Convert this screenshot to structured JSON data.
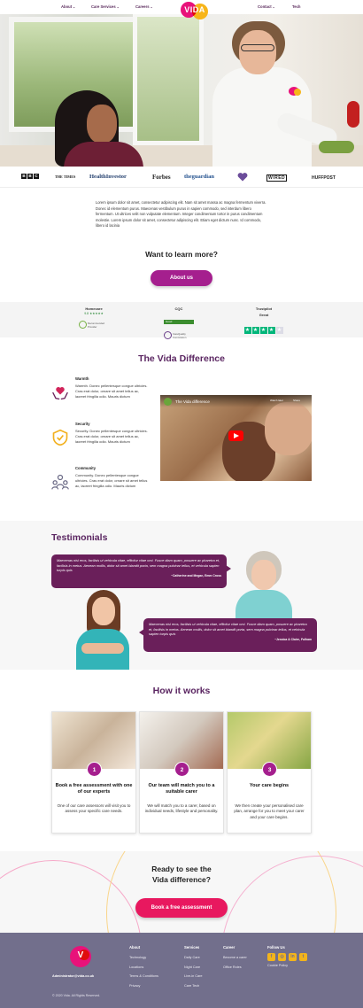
{
  "nav": {
    "about": "About",
    "care_services": "Care Services",
    "careers": "Careers",
    "contact": "Contact",
    "tech": "Tech",
    "logo_text": "VIDA"
  },
  "press_logos": {
    "bbc": [
      "B",
      "B",
      "C"
    ],
    "times": "THE TIMES",
    "health_investor": "HealthInvestor",
    "forbes": "Forbes",
    "guardian": "theguardian",
    "wired": "WIRED",
    "huffpost": "HUFFPOST"
  },
  "intro": {
    "text": "Lorem ipsum dolor sit amet, consectetur adipiscing elit. Nam sit amet massa ac magna fermentum viverra. Donec id elementum purus. Maecenas vestibulum purus in sapien commodo, sed interdum libero fermentum. Ut ultrices velit non vulputate elementum. Integer condimentum tortor in purus condimentum molestie. Lorem ipsum dolor sit amet, consectetur adipiscing elit. Etiam eget dictum nunc. Id commodo, libero id lacinia"
  },
  "learn_more": {
    "title": "Want to learn more?",
    "button": "About us"
  },
  "ratings": {
    "homecare_label": "Homecare",
    "homecare_score": "9.8 ★★★★★",
    "homecare_badge": "Recommended Provider",
    "cqc_label": "CQC",
    "cqc_rating": "Good",
    "cqc_badge": "CareQuality Commission",
    "trustpilot_label": "Trustpilot",
    "trustpilot_rating": "Great",
    "trustpilot_stars": 4
  },
  "difference": {
    "title": "The Vida Difference",
    "features": [
      {
        "title": "Warmth",
        "text": "Warmth. Donec pellentesque congue ultricies. Cras erat dolor, ornare sit amet tellus ac, laoreet fringilla odio. Mauris dictum"
      },
      {
        "title": "Security",
        "text": "Security. Donec pellentesque congue ultricies. Cras erat dolor, ornare sit amet tellus ac, laoreet fringilla odio. Mauris dictum"
      },
      {
        "title": "Community",
        "text": "Community. Donec pellentesque congue ultricies. Cras erat dolor, ornare sit amet tellus ac, laoreet fringilla odio. Mauris dictum"
      }
    ],
    "video_title": "The Vida difference",
    "video_watch_later": "Watch later",
    "video_share": "Share"
  },
  "testimonials": {
    "title": "Testimonials",
    "items": [
      {
        "quote": "Maecenas nisl eros, facilisis ut vehicula vitae, efficitur vitae orci. Fusce diam quam, posuere ac pharetra et, facilisis in metus. Aenean mollis, dolor sit amet blandit porta, sem magna pulvinar tellus, et vehicula sapien turpis quis",
        "author": "~Catherine and Megan, Emm Cross"
      },
      {
        "quote": "Maecenas nisl eros, facilisis ut vehicula vitae, efficitur vitae orci. Fusce diam quam, posuere ac pharetra et, facilisis in metus. Aenean mollis, dolor sit amet blandit porta, sem magna pulvinar tellus, et vehicula sapien turpis quis",
        "author": "~Jessica & Claire, Fulham"
      }
    ]
  },
  "how_it_works": {
    "title": "How it works",
    "steps": [
      {
        "num": "1",
        "title": "Book a free assessment with one of our experts",
        "text": "One of our care assessors will visit you to assess your specific care needs."
      },
      {
        "num": "2",
        "title": "Our team will match you to a suitable carer",
        "text": "We will match you to a carer, based on individual needs, lifestyle and personality."
      },
      {
        "num": "3",
        "title": "Your care begins",
        "text": "We then create your personalised care plan, arrange for you to meet your carer and your care begins."
      }
    ]
  },
  "cta": {
    "title_line1": "Ready to see the",
    "title_line2": "Vida difference?",
    "button": "Book a free assessment"
  },
  "footer": {
    "logo_text": "V",
    "email": "Administrator@vida.co.uk",
    "copyright": "© 2020 Vida. All Rights Reserved.",
    "about": {
      "title": "About",
      "items": [
        "Technology",
        "Locations",
        "Terms & Conditions",
        "Privacy"
      ]
    },
    "services": {
      "title": "Services",
      "items": [
        "Daily Care",
        "Night Care",
        "Live-in Care",
        "Care Tech"
      ]
    },
    "career": {
      "title": "Career",
      "items": [
        "Become a carer",
        "Office Roles"
      ]
    },
    "follow": {
      "title": "Follow Us",
      "icons": [
        "f",
        "◎",
        "in",
        "t"
      ],
      "privacy": "Cookie Policy"
    }
  },
  "colors": {
    "brand_purple": "#5a2561",
    "button_purple": "#a51f8e",
    "cta_pink": "#e8185f",
    "footer_bg": "#726f8c",
    "logo_pink": "#e8127a",
    "logo_yellow": "#f7b519"
  }
}
